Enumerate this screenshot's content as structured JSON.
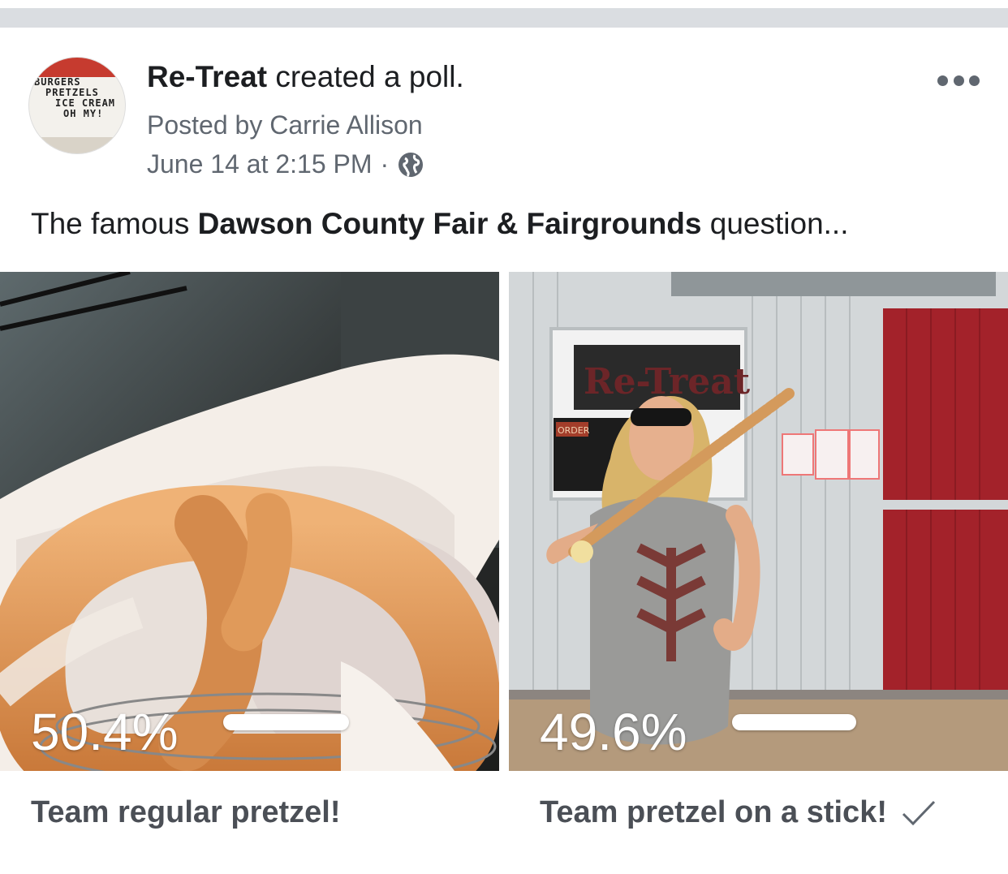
{
  "post": {
    "page_name": "Re-Treat",
    "action": "created a poll.",
    "posted_by": "Posted by Carrie Allison",
    "date": "June 14 at 2:15 PM",
    "separator": "·",
    "privacy_icon": "globe-icon",
    "menu_icon": "more-icon",
    "avatar_sign": [
      "BURGERS",
      "PRETZELS",
      "ICE CREAM",
      "OH MY!"
    ]
  },
  "message": {
    "prefix": "The famous ",
    "tagged_page": "Dawson County Fair & Fairgrounds",
    "suffix": " question..."
  },
  "poll": {
    "options": [
      {
        "percent_label": "50.4%",
        "percent": 50.4,
        "label": "Team regular pretzel!",
        "selected": false
      },
      {
        "percent_label": "49.6%",
        "percent": 49.6,
        "label": "Team pretzel on a stick!",
        "selected": true
      }
    ],
    "photo_sign": "Re-Treat",
    "photo_order_label": "ORDER"
  },
  "colors": {
    "text_primary": "#1c1e21",
    "text_secondary": "#606770",
    "label_text": "#4b4f56",
    "divider": "#dadde1",
    "barn_red": "#a3222a"
  }
}
